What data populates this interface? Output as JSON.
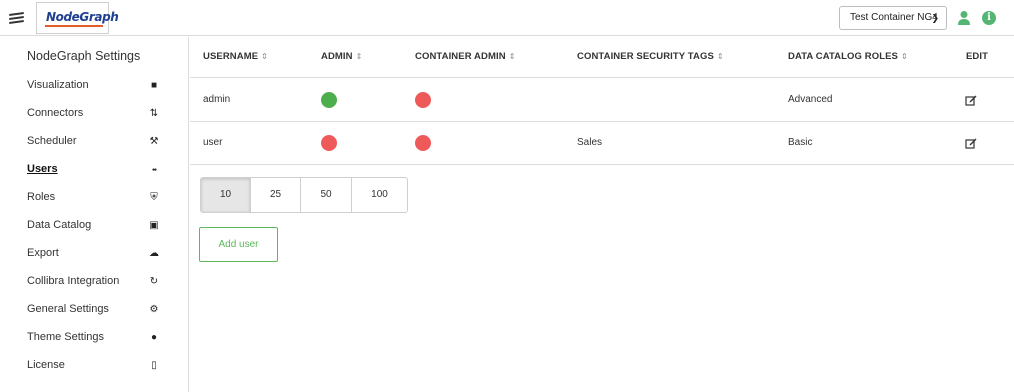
{
  "header": {
    "logo_text": "NodeGraph",
    "container_selector": "Test Container NG4",
    "accent_color": "#54b574"
  },
  "sidebar": {
    "title": "NodeGraph Settings",
    "items": [
      {
        "label": "Visualization",
        "icon": "folder-icon"
      },
      {
        "label": "Connectors",
        "icon": "arrows-updown-icon"
      },
      {
        "label": "Scheduler",
        "icon": "wrench-icon"
      },
      {
        "label": "Users",
        "icon": "users-icon",
        "active": true
      },
      {
        "label": "Roles",
        "icon": "shield-icon"
      },
      {
        "label": "Data Catalog",
        "icon": "inbox-icon"
      },
      {
        "label": "Export",
        "icon": "cloud-download-icon"
      },
      {
        "label": "Collibra Integration",
        "icon": "sync-icon"
      },
      {
        "label": "General Settings",
        "icon": "gear-icon"
      },
      {
        "label": "Theme Settings",
        "icon": "palette-icon"
      },
      {
        "label": "License",
        "icon": "file-icon"
      }
    ]
  },
  "table": {
    "columns": [
      "USERNAME",
      "ADMIN",
      "CONTAINER ADMIN",
      "CONTAINER SECURITY TAGS",
      "DATA CATALOG ROLES",
      "EDIT"
    ],
    "rows": [
      {
        "username": "admin",
        "admin": true,
        "container_admin": false,
        "security_tags": "",
        "data_catalog_roles": "Advanced"
      },
      {
        "username": "user",
        "admin": false,
        "container_admin": false,
        "security_tags": "Sales",
        "data_catalog_roles": "Basic"
      }
    ],
    "status_colors": {
      "true": "#4cae4c",
      "false": "#ee5a5a"
    }
  },
  "pagination": {
    "options": [
      "10",
      "25",
      "50",
      "100"
    ],
    "selected": "10"
  },
  "actions": {
    "add_user_label": "Add user"
  }
}
